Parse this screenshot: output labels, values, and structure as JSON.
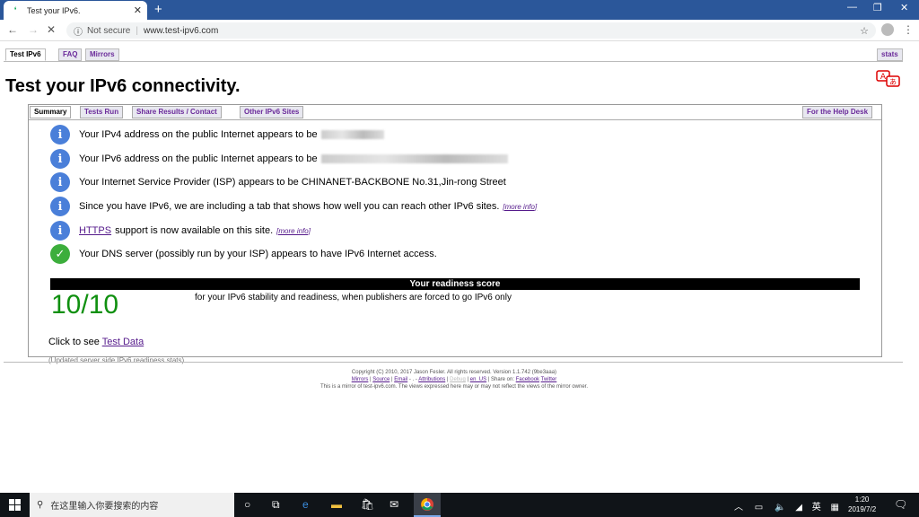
{
  "browser": {
    "tab_title": "Test your IPv6.",
    "security": "Not secure",
    "url": "www.test-ipv6.com"
  },
  "top_tabs": [
    "Test IPv6",
    "FAQ",
    "Mirrors"
  ],
  "stats_tab": "stats",
  "heading": "Test your IPv6 connectivity.",
  "panel_tabs": [
    "Summary",
    "Tests Run",
    "Share Results / Contact",
    "Other IPv6 Sites"
  ],
  "help_tab": "For the Help Desk",
  "results": {
    "ipv4": "Your IPv4 address on the public Internet appears to be",
    "ipv6": "Your IPv6 address on the public Internet appears to be",
    "isp": "Your Internet Service Provider (ISP) appears to be CHINANET-BACKBONE No.31,Jin-rong Street",
    "tab_note": "Since you have IPv6, we are including a tab that shows how well you can reach other IPv6 sites.",
    "more_info": "[more info]",
    "https_link": "HTTPS",
    "https_rest": "support is now available on this site.",
    "dns": "Your DNS server (possibly run by your ISP) appears to have IPv6 Internet access."
  },
  "score": {
    "header": "Your readiness score",
    "value": "10/10",
    "description": "for your IPv6 stability and readiness, when publishers are forced to go IPv6 only"
  },
  "click_to_see": "Click to see",
  "test_data_link": "Test Data",
  "updated_note": "(Updated server side IPv6 readiness stats)",
  "footer": {
    "line1": "Copyright (C) 2010, 2017 Jason Fesler. All rights reserved. Version 1.1.742 (9be3aaa)",
    "links": [
      "Mirrors",
      "Source",
      "Email",
      "Attributions",
      "Debug",
      "en_US",
      "Facebook",
      "Twitter"
    ],
    "share_on": "Share on:",
    "line3": "This is a mirror of test-ipv6.com. The views expressed here may or may not reflect the views of the mirror owner."
  },
  "taskbar": {
    "search_placeholder": "在这里输入你要搜索的内容",
    "ime": "英",
    "time": "1:20",
    "date": "2019/7/2"
  }
}
